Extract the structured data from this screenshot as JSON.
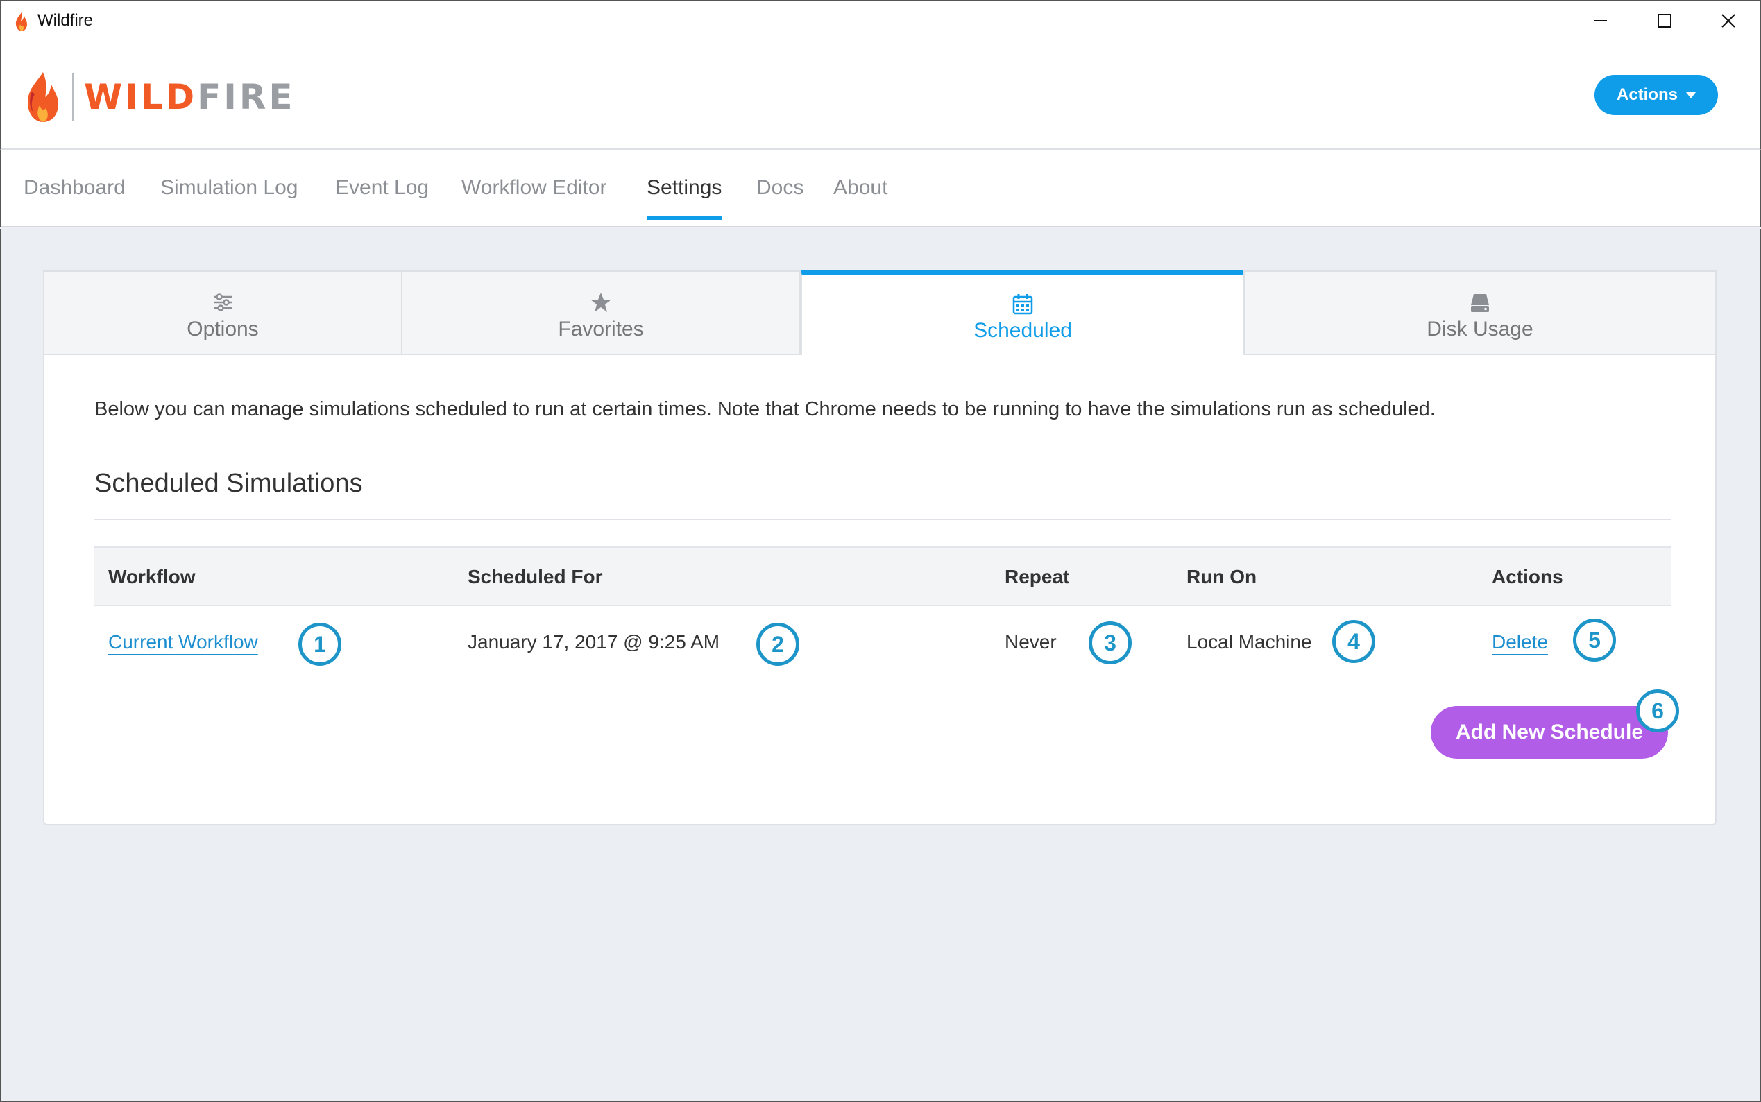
{
  "window": {
    "title": "Wildfire",
    "controls": [
      "minimize-icon",
      "maximize-icon",
      "close-icon"
    ]
  },
  "header": {
    "logo_part1": "WILD",
    "logo_part2": "FIRE",
    "actions_label": "Actions"
  },
  "nav": {
    "items": [
      {
        "label": "Dashboard"
      },
      {
        "label": "Simulation Log"
      },
      {
        "label": "Event Log"
      },
      {
        "label": "Workflow Editor"
      },
      {
        "label": "Settings",
        "active": true
      },
      {
        "label": "Docs"
      },
      {
        "label": "About"
      }
    ]
  },
  "tabs": [
    {
      "label": "Options",
      "icon": "sliders-icon"
    },
    {
      "label": "Favorites",
      "icon": "star-icon"
    },
    {
      "label": "Scheduled",
      "icon": "calendar-icon",
      "active": true
    },
    {
      "label": "Disk Usage",
      "icon": "disk-icon"
    }
  ],
  "scheduled": {
    "intro": "Below you can manage simulations scheduled to run at certain times. Note that Chrome needs to be running to have the simulations run as scheduled.",
    "section_title": "Scheduled Simulations",
    "columns": [
      "Workflow",
      "Scheduled For",
      "Repeat",
      "Run On",
      "Actions"
    ],
    "rows": [
      {
        "workflow": "Current Workflow",
        "scheduled_for": "January 17, 2017 @ 9:25 AM",
        "repeat": "Never",
        "run_on": "Local Machine",
        "action": "Delete"
      }
    ],
    "add_button": "Add New Schedule"
  },
  "callouts": [
    "1",
    "2",
    "3",
    "4",
    "5",
    "6"
  ],
  "colors": {
    "accent": "#0f9ce8",
    "add_button": "#b15de8",
    "callout": "#1e95c8",
    "logo_orange": "#f15a24"
  }
}
